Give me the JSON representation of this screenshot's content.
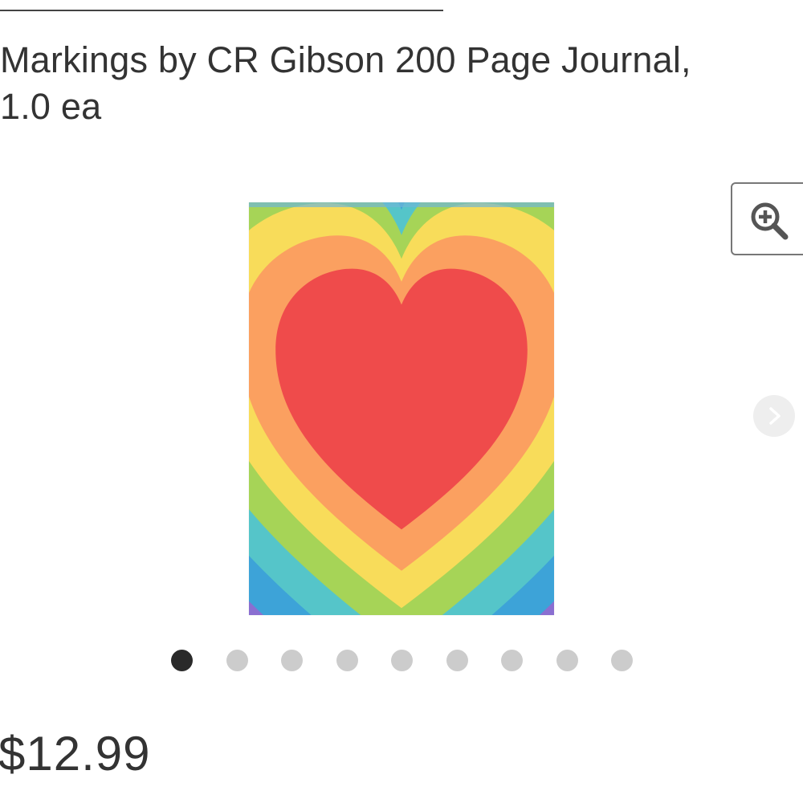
{
  "product": {
    "title": "Markings by CR Gibson 200 Page Journal,\n1.0 ea",
    "price": "$12.99",
    "image": {
      "name": "rainbow-heart-journal-cover",
      "colors": [
        "#e9617a",
        "#8a6fd1",
        "#3da3d8",
        "#55c5c9",
        "#a6d457",
        "#f8dc5a",
        "#fba060",
        "#ef4b4b"
      ]
    }
  },
  "carousel": {
    "zoom_icon": "zoom-in-icon",
    "next_icon": "chevron-right-icon",
    "page_count": 9,
    "active_index": 0
  }
}
